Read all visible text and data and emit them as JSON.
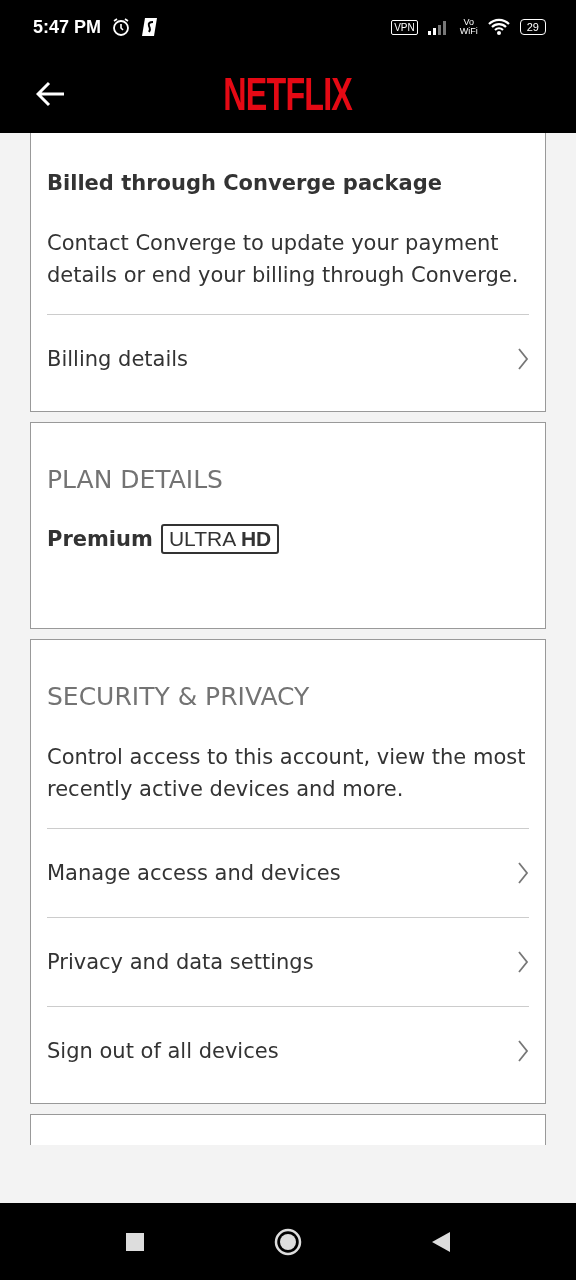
{
  "status_bar": {
    "time": "5:47 PM",
    "vpn": "VPN",
    "network": [
      "Vo",
      "WiFi"
    ],
    "battery": "29"
  },
  "header": {
    "logo": "NETFLIX"
  },
  "cards": [
    {
      "subtitle": "Billed through Converge package",
      "description": "Contact Converge to update your payment details or end your billing through Converge.",
      "links": [
        "Billing details"
      ]
    },
    {
      "heading": "PLAN DETAILS",
      "plan": "Premium",
      "badge": "ULTRA **HD**"
    },
    {
      "heading": "SECURITY & PRIVACY",
      "description": "Control access to this account, view the most recently active devices and more.",
      "links": [
        "Manage access and devices",
        "Privacy and data settings",
        "Sign out of all devices"
      ]
    }
  ]
}
